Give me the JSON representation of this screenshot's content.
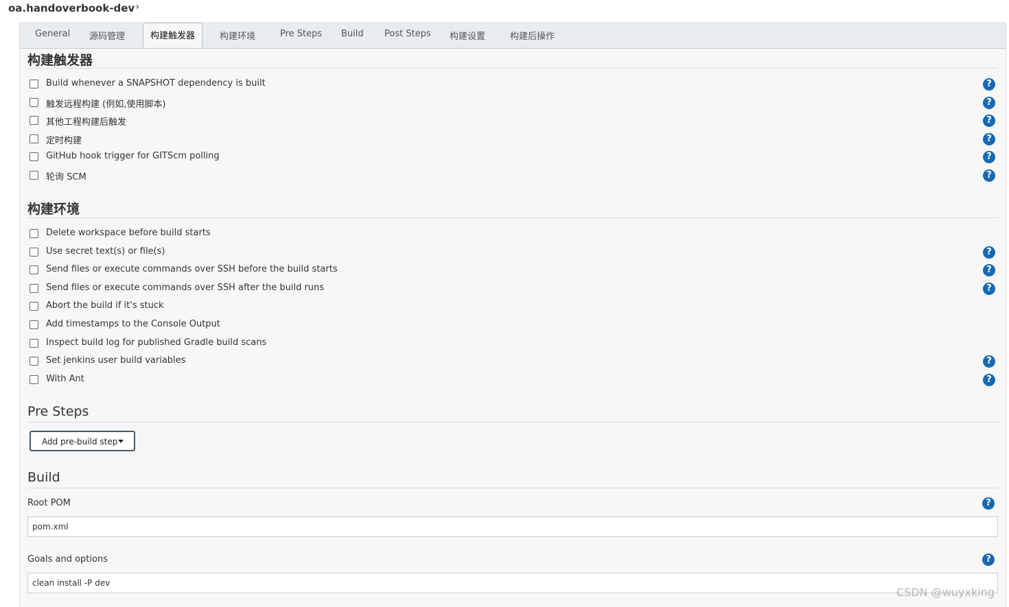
{
  "breadcrumb": {
    "job_name": "oa.handoverbook-dev"
  },
  "tabs": [
    {
      "label": "General"
    },
    {
      "label": "源码管理"
    },
    {
      "label": "构建触发器"
    },
    {
      "label": "构建环境"
    },
    {
      "label": "Pre Steps"
    },
    {
      "label": "Build"
    },
    {
      "label": "Post Steps"
    },
    {
      "label": "构建设置"
    },
    {
      "label": "构建后操作"
    }
  ],
  "active_tab": "构建触发器",
  "triggers": {
    "title": "构建触发器",
    "items": [
      {
        "label": "Build whenever a SNAPSHOT dependency is built",
        "checked": false,
        "help": true
      },
      {
        "label": "触发远程构建 (例如,使用脚本)",
        "checked": false,
        "help": true
      },
      {
        "label": "其他工程构建后触发",
        "checked": false,
        "help": true
      },
      {
        "label": "定时构建",
        "checked": false,
        "help": true
      },
      {
        "label": "GitHub hook trigger for GITScm polling",
        "checked": false,
        "help": true
      },
      {
        "label": "轮询 SCM",
        "checked": false,
        "help": true
      }
    ]
  },
  "environment": {
    "title": "构建环境",
    "items": [
      {
        "label": "Delete workspace before build starts",
        "checked": false,
        "help": false
      },
      {
        "label": "Use secret text(s) or file(s)",
        "checked": false,
        "help": true
      },
      {
        "label": "Send files or execute commands over SSH before the build starts",
        "checked": false,
        "help": true
      },
      {
        "label": "Send files or execute commands over SSH after the build runs",
        "checked": false,
        "help": true
      },
      {
        "label": "Abort the build if it's stuck",
        "checked": false,
        "help": false
      },
      {
        "label": "Add timestamps to the Console Output",
        "checked": false,
        "help": false
      },
      {
        "label": "Inspect build log for published Gradle build scans",
        "checked": false,
        "help": false
      },
      {
        "label": "Set jenkins user build variables",
        "checked": false,
        "help": true
      },
      {
        "label": "With Ant",
        "checked": false,
        "help": true
      }
    ]
  },
  "pre_steps": {
    "title": "Pre Steps",
    "add_button_label": "Add pre-build step"
  },
  "build": {
    "title": "Build",
    "root_pom_label": "Root POM",
    "root_pom_value": "pom.xml",
    "goals_label": "Goals and options",
    "goals_value": "clean install -P dev"
  },
  "help_glyph": "?",
  "watermark": "CSDN @wuyxking",
  "colors": {
    "help_icon": "#1769b3",
    "panel_bg": "#f7f7f7",
    "tabbar_bg": "#e8ecef"
  }
}
